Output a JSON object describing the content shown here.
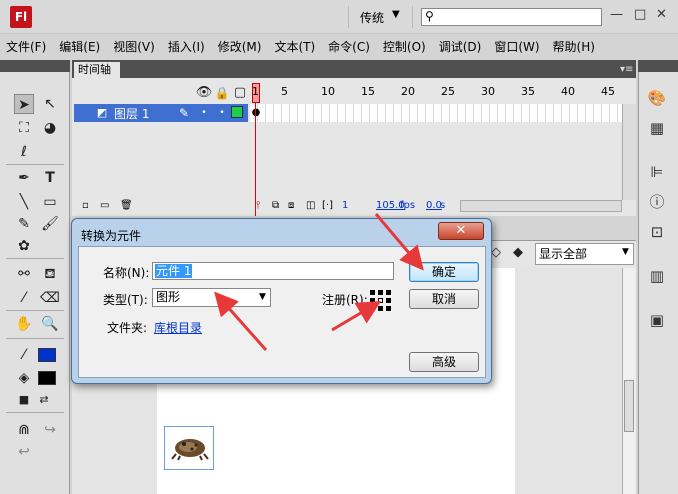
{
  "app": {
    "logo_text": "Fl",
    "workspace": "传统",
    "search_placeholder": ""
  },
  "menu": [
    "文件(F)",
    "编辑(E)",
    "视图(V)",
    "插入(I)",
    "修改(M)",
    "文本(T)",
    "命令(C)",
    "控制(O)",
    "调试(D)",
    "窗口(W)",
    "帮助(H)"
  ],
  "timeline": {
    "tab_label": "时间轴",
    "layer_name": "图层 1",
    "frame_numbers": [
      "1",
      "5",
      "10",
      "15",
      "20",
      "25",
      "30",
      "35",
      "40",
      "45"
    ],
    "current_frame": "1",
    "fps": "105.0",
    "fps_unit": "fps",
    "time": "0.0",
    "time_unit": "s"
  },
  "stage": {
    "zoom": "显示全部"
  },
  "dialog": {
    "title": "转换为元件",
    "close_symbol": "✕",
    "name_label": "名称(N):",
    "name_value": "元件 1",
    "type_label": "类型(T):",
    "type_value": "图形",
    "registration_label": "注册(R):",
    "folder_label": "文件夹:",
    "folder_link": "库根目录",
    "ok_label": "确定",
    "cancel_label": "取消",
    "advanced_label": "高级"
  },
  "colors": {
    "stroke_swatch": "#0033cc",
    "fill_swatch": "#000000",
    "arrow": "#e8393a",
    "layer_selected": "#3f6fd0"
  }
}
